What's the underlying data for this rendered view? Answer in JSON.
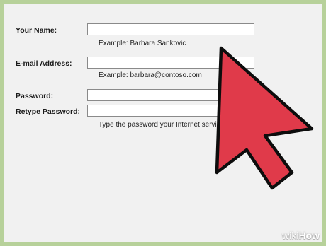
{
  "form": {
    "fields": [
      {
        "label": "Your Name:",
        "value": "",
        "hint": "Example: Barbara Sankovic"
      },
      {
        "label": "E-mail Address:",
        "value": "",
        "hint": "Example: barbara@contoso.com"
      },
      {
        "label": "Password:",
        "value": ""
      },
      {
        "label": "Retype Password:",
        "value": "",
        "hint": "Type the password your Internet servi"
      }
    ]
  },
  "overlay": {
    "icon": "cursor-arrow-icon",
    "arrow_color": "#e03a4a"
  },
  "watermark": {
    "part1": "wiki",
    "part2": "How"
  }
}
